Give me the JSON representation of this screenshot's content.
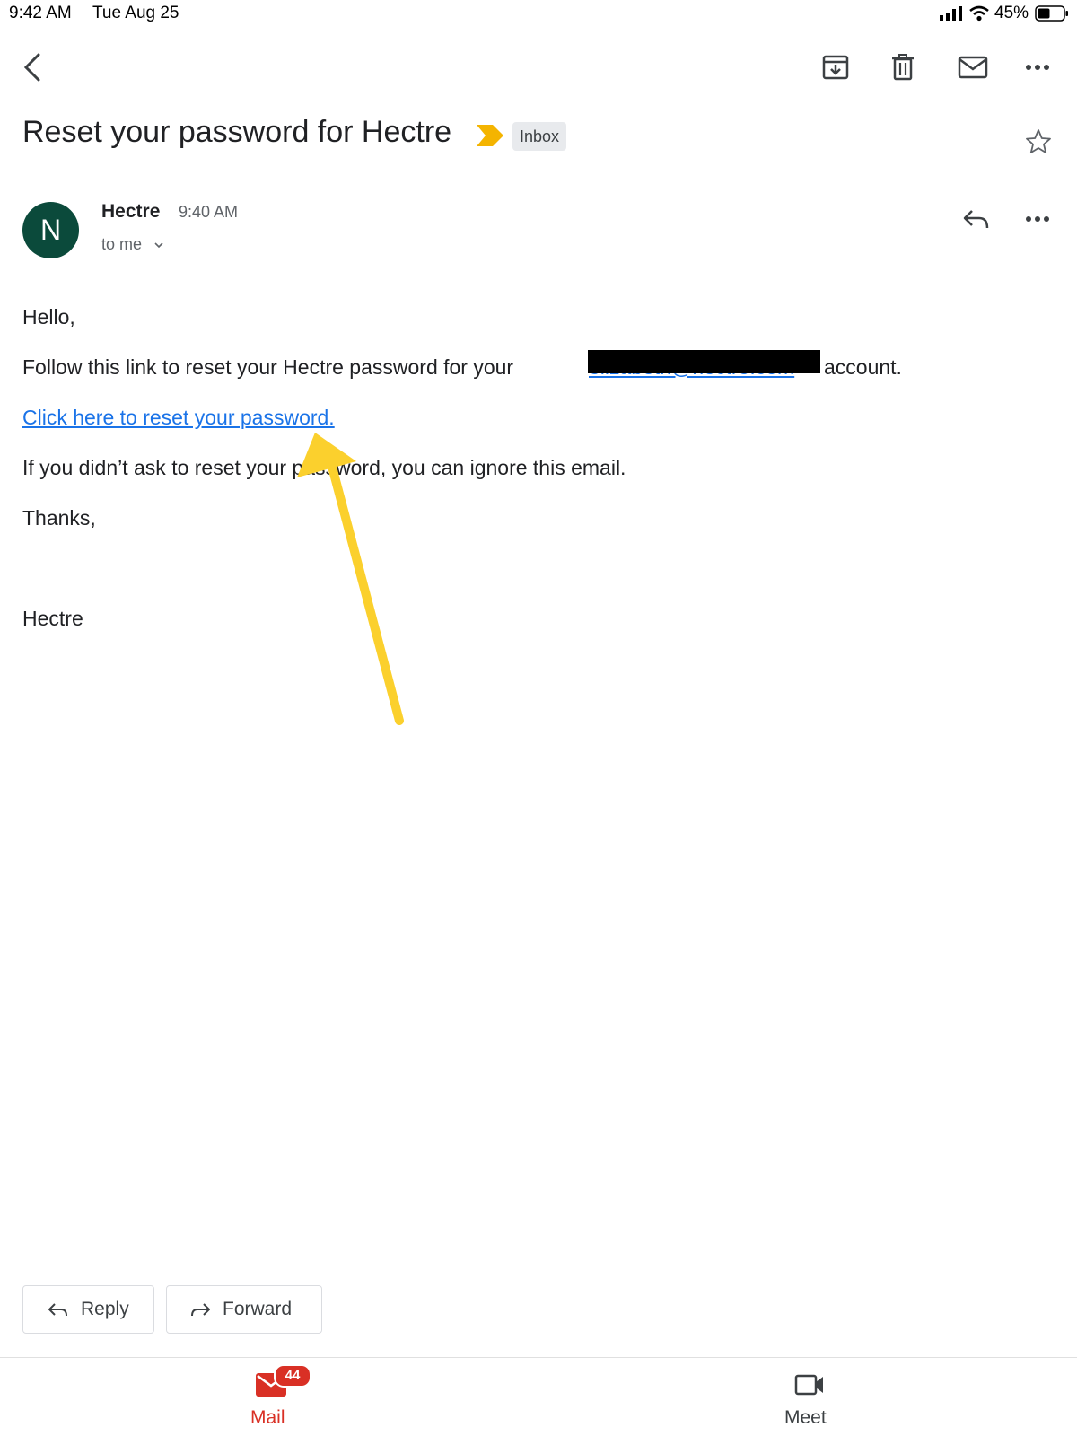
{
  "status_bar": {
    "time": "9:42 AM",
    "date": "Tue Aug 25",
    "battery": "45%"
  },
  "toolbar": {
    "back_icon": "chevron-left-icon",
    "archive_icon": "archive-icon",
    "delete_icon": "trash-icon",
    "mark_unread_icon": "mail-icon",
    "more_icon": "more-horizontal-icon"
  },
  "message": {
    "subject": "Reset your password for Hectre",
    "label": "Inbox",
    "importance_color": "#f4b400",
    "sender": {
      "initial": "N",
      "avatar_color": "#0b4a3b",
      "name": "Hectre",
      "time": "9:40 AM",
      "recipient": "to me"
    },
    "body": {
      "greeting": "Hello,",
      "line1_start": "Follow this link to reset your Hectre password for your",
      "line1_end": "account.",
      "redacted_email": "elizabeth@hectre.com",
      "reset_link": "Click here to reset your password.",
      "line3": "If you didn’t ask to reset your password, you can ignore this email.",
      "thanks": "Thanks,",
      "signature": "Hectre"
    },
    "annotation_color": "#fbd02d"
  },
  "actions": {
    "reply": "Reply",
    "forward": "Forward"
  },
  "bottom_nav": {
    "mail_label": "Mail",
    "mail_badge": "44",
    "meet_label": "Meet",
    "active_color": "#d93025"
  }
}
